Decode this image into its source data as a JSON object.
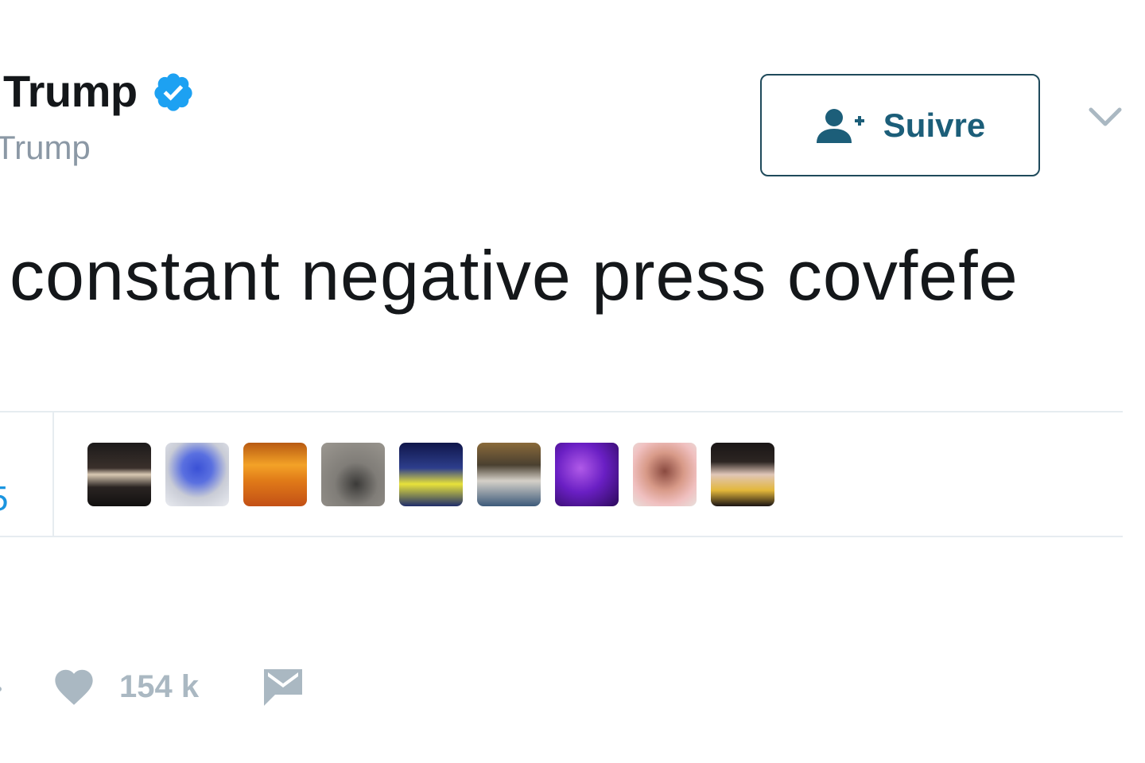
{
  "header": {
    "display_name": "Trump",
    "handle": "Trump",
    "verified_icon": "verified-badge-icon",
    "follow_label": "Suivre",
    "follow_icon": "add-user-icon",
    "more_icon": "chevron-down-icon"
  },
  "tweet": {
    "text": "constant negative press covfefe"
  },
  "stats": {
    "count_fragment": "5",
    "avatars": [
      "avatar-1",
      "avatar-2",
      "avatar-3",
      "avatar-4",
      "avatar-5",
      "avatar-6",
      "avatar-7",
      "avatar-8",
      "avatar-9"
    ]
  },
  "actions": {
    "like_icon": "heart-icon",
    "like_count": "154 k",
    "dm_icon": "envelope-icon"
  },
  "colors": {
    "verified": "#1da1f2",
    "follow_text": "#1c5e79",
    "muted": "#aab8c2",
    "link": "#1b95e0"
  }
}
